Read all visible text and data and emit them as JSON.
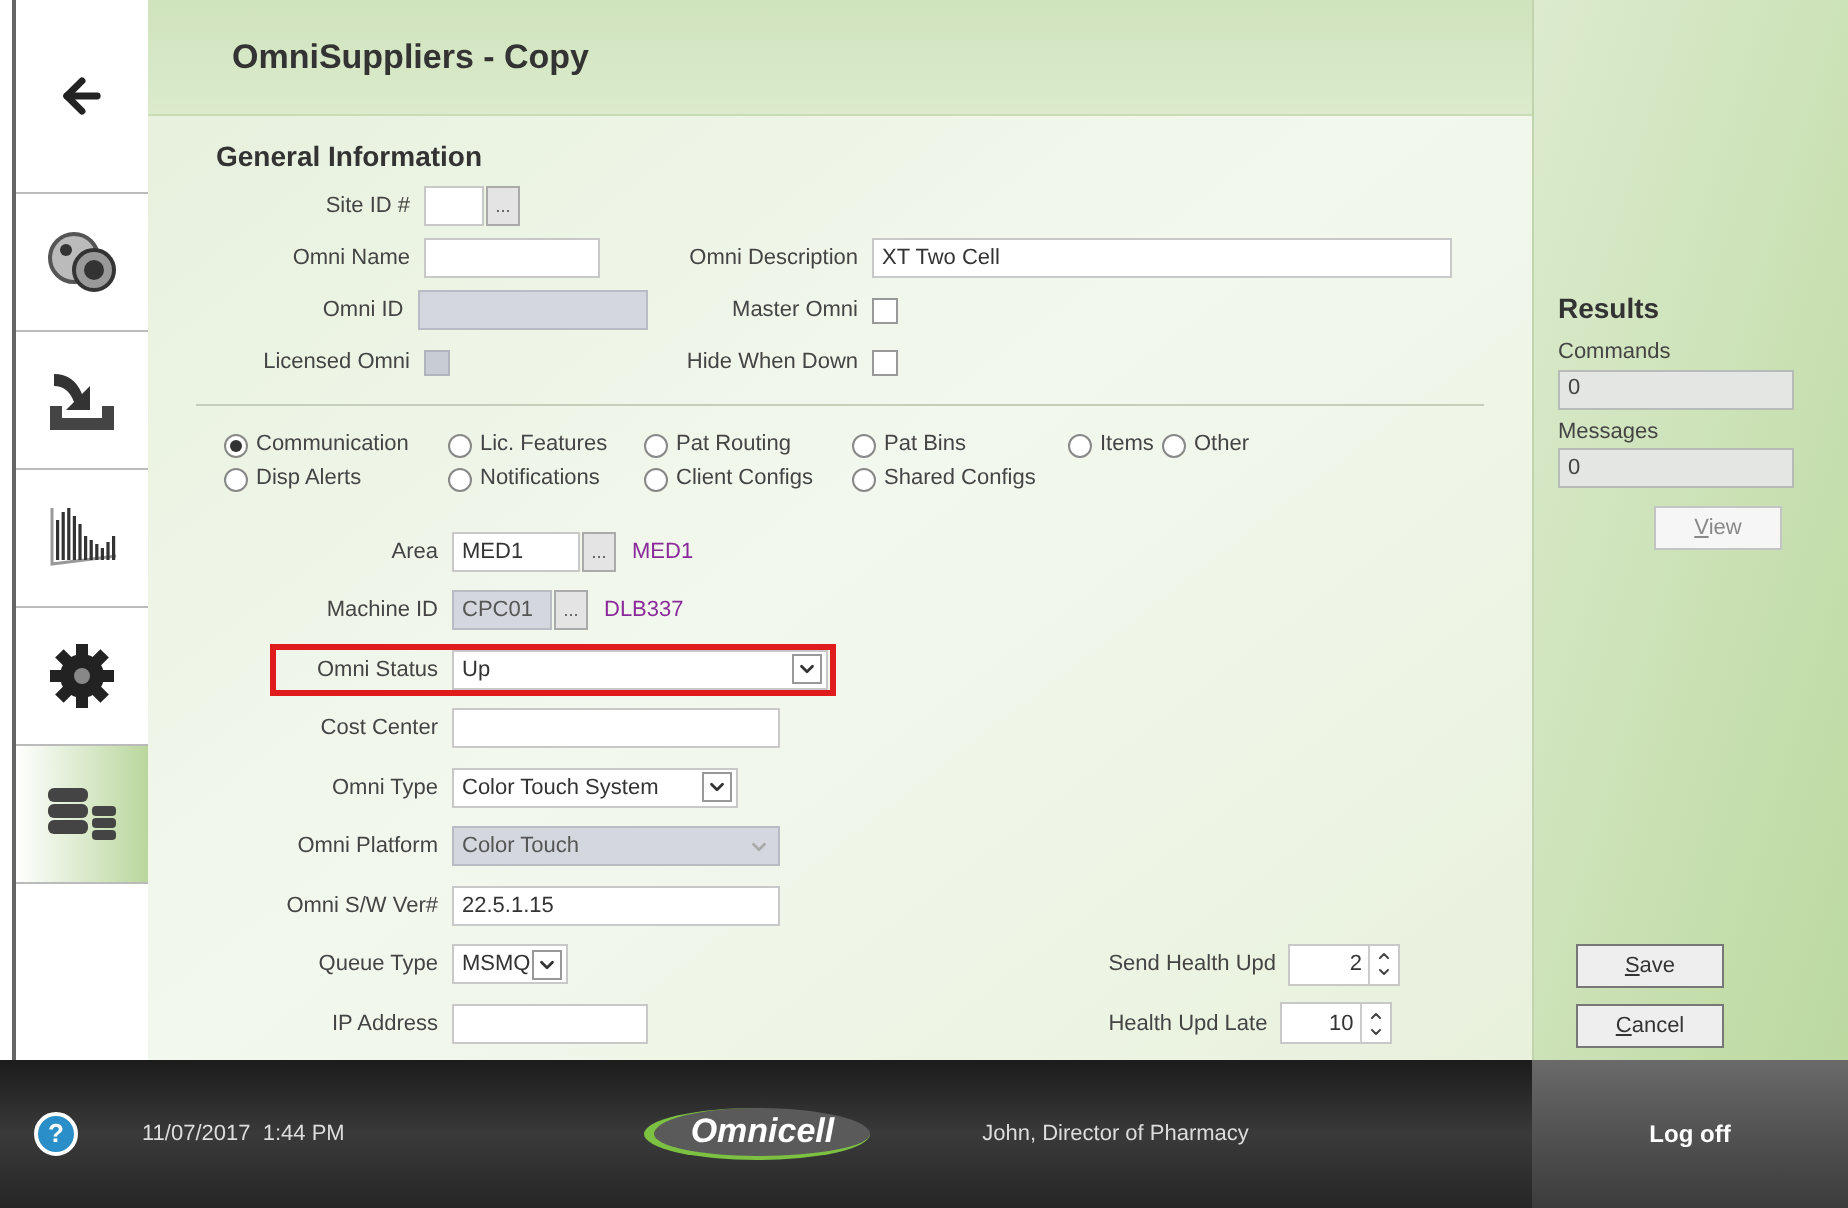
{
  "sidebar": {
    "items": [
      {
        "kind": "back",
        "selected": false
      },
      {
        "kind": "discs",
        "selected": false
      },
      {
        "kind": "tray",
        "selected": false
      },
      {
        "kind": "chart",
        "selected": false
      },
      {
        "kind": "gear",
        "selected": false
      },
      {
        "kind": "database",
        "selected": true
      }
    ]
  },
  "title": "OmniSuppliers - Copy",
  "general": {
    "heading": "General Information",
    "rows": [
      [
        {
          "label": "Site ID #",
          "kind": "lookup",
          "browse": "...",
          "disabled": false
        }
      ],
      [
        {
          "label": "Omni Name",
          "kind": "text",
          "disabled": false
        },
        {
          "label": "Omni Description",
          "kind": "text",
          "value": "XT Two Cell",
          "disabled": false
        }
      ],
      [
        {
          "label": "Omni ID",
          "kind": "text",
          "disabled": true
        },
        {
          "label": "Master Omni",
          "kind": "checkbox",
          "checked": false,
          "disabled": false
        }
      ],
      [
        {
          "label": "Licensed Omni",
          "kind": "checkbox",
          "checked": false,
          "disabled": true
        },
        {
          "label": "Hide When Down",
          "kind": "checkbox",
          "checked": false,
          "disabled": false
        }
      ]
    ]
  },
  "options": [
    {
      "label": "Communication",
      "selected": true
    },
    {
      "label": "Lic. Features",
      "selected": false
    },
    {
      "label": "Pat Routing",
      "selected": false
    },
    {
      "label": "Pat Bins",
      "selected": false
    },
    {
      "label": "Items",
      "selected": false
    },
    {
      "label": "Other",
      "selected": false
    },
    {
      "label": "Disp Alerts",
      "selected": false
    },
    {
      "label": "Notifications",
      "selected": false
    },
    {
      "label": "Client Configs",
      "selected": false
    },
    {
      "label": "Shared Configs",
      "selected": false
    }
  ],
  "fields": [
    {
      "label": "Area",
      "kind": "lookup",
      "value": "MED1",
      "browse": "...",
      "note": "MED1",
      "disabled": false,
      "highlighted": false
    },
    {
      "label": "Machine ID",
      "kind": "lookup",
      "value": "CPC01",
      "browse": "...",
      "note": "DLB337",
      "disabled": true,
      "highlighted": false
    },
    {
      "label": "Omni Status",
      "kind": "select",
      "value": "Up",
      "disabled": false,
      "highlighted": true
    },
    {
      "label": "Cost Center",
      "kind": "text",
      "disabled": false,
      "highlighted": false
    },
    {
      "label": "Omni Type",
      "kind": "select",
      "value": "Color Touch System",
      "disabled": false,
      "highlighted": false
    },
    {
      "label": "Omni Platform",
      "kind": "select",
      "value": "Color Touch",
      "disabled": true,
      "highlighted": false
    },
    {
      "label": "Omni S/W Ver#",
      "kind": "text",
      "value": "22.5.1.15",
      "disabled": false,
      "highlighted": false
    },
    {
      "label": "Queue Type",
      "kind": "select",
      "value": "MSMQ",
      "disabled": false,
      "highlighted": false
    },
    {
      "label": "IP Address",
      "kind": "text",
      "disabled": false,
      "highlighted": false
    }
  ],
  "health": [
    {
      "label": "Send Health Upd",
      "value": "2"
    },
    {
      "label": "Health Upd Late",
      "value": "10"
    }
  ],
  "results": {
    "heading": "Results",
    "fields": [
      {
        "label": "Commands",
        "value": "0"
      },
      {
        "label": "Messages",
        "value": "0"
      }
    ],
    "view_button": "View"
  },
  "actions": [
    "Save",
    "Cancel"
  ],
  "footer": {
    "help": "?",
    "datetime": "11/07/2017  1:44 PM",
    "logo": "Omnicell",
    "user": "John, Director of Pharmacy",
    "logoff": "Log off"
  }
}
